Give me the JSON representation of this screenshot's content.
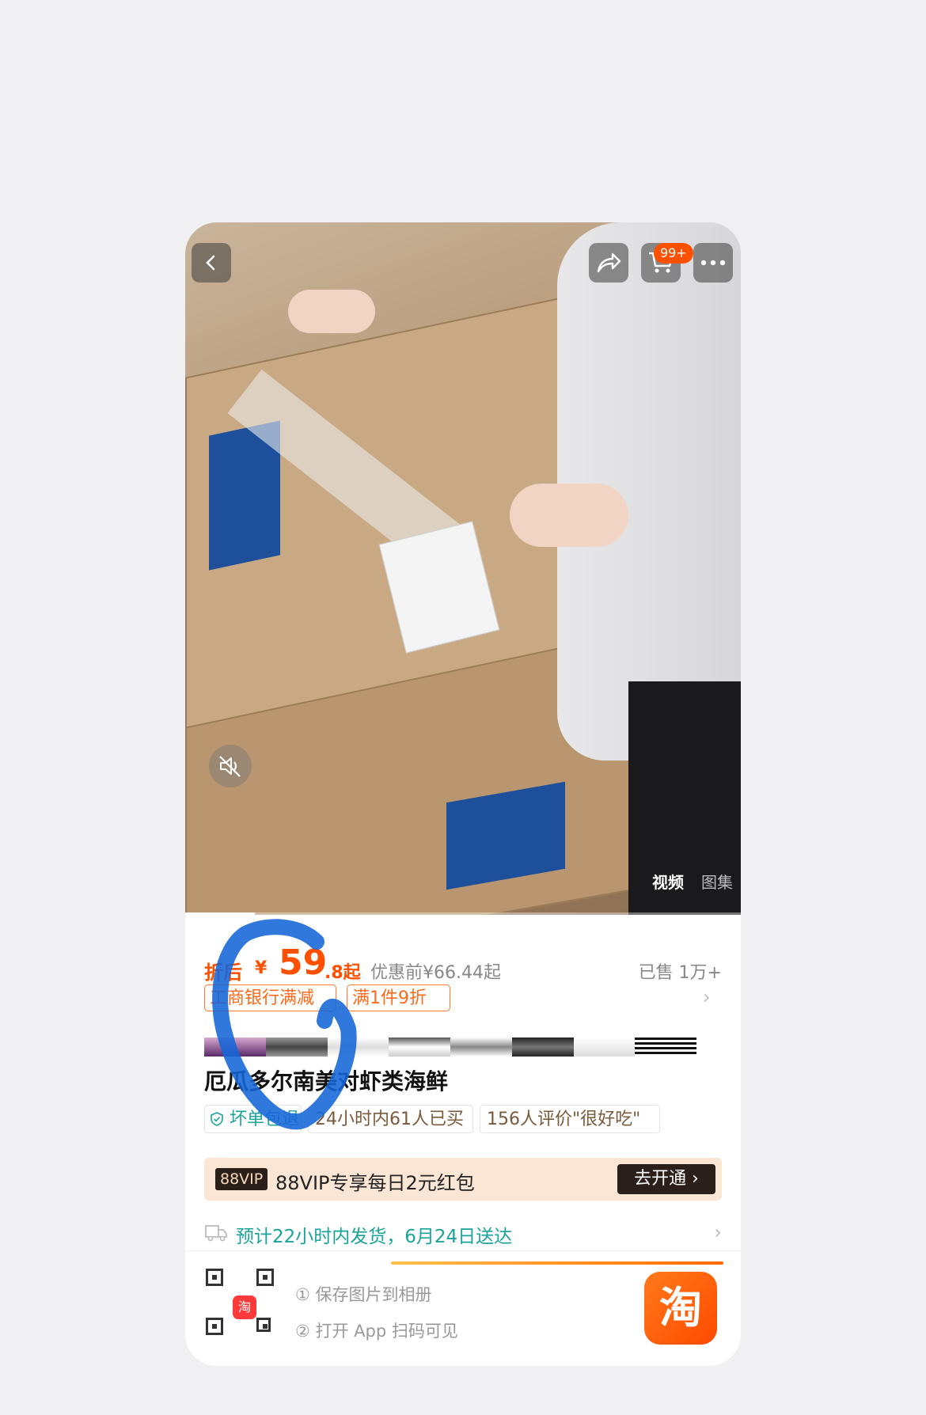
{
  "header": {
    "cart_badge": "99+"
  },
  "media": {
    "tabs": [
      "视频",
      "图集"
    ],
    "progress": 0.125
  },
  "price": {
    "prefix": "折后",
    "currency": "¥",
    "integer": "59",
    "decimal": ".8起",
    "original": "优惠前¥66.44起",
    "sold": "已售 1万+"
  },
  "promos": [
    "工商银行满减",
    "满1件9折"
  ],
  "product": {
    "title": "厄瓜多尔南美对虾类海鲜"
  },
  "services": [
    "坏单包退",
    "24小时内61人已买",
    "156人评价\"很好吃\""
  ],
  "vip": {
    "badge": "88VIP",
    "text": "88VIP专享每日2元红包",
    "button": "去开通"
  },
  "shipping": {
    "text": "预计22小时内发货，6月24日送达"
  },
  "footer": {
    "step1": "① 保存图片到相册",
    "step2": "② 打开 App 扫码可见",
    "qr_logo": "淘",
    "app_logo": "淘"
  },
  "colors": {
    "accent": "#ff5000",
    "teal": "#1aa39a",
    "annotation": "#1565d8"
  }
}
